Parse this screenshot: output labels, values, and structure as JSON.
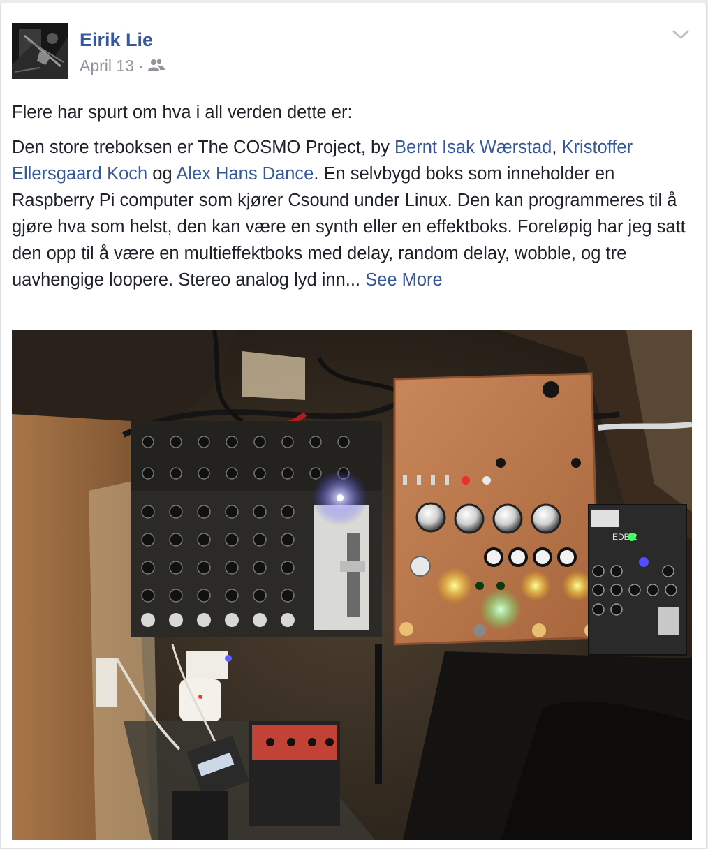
{
  "post": {
    "author": "Eirik Lie",
    "date": "April 13",
    "separator": "·",
    "audience_icon": "friends-icon",
    "options_icon": "chevron-down-icon",
    "intro": "Flere har spurt om hva i all verden dette er:",
    "text_before_link1": "Den store treboksen er The COSMO Project, by ",
    "link1": "Bernt Isak Wærstad",
    "sep1": ",",
    "link2": "Kristoffer Ellersgaard Koch",
    "og": " og ",
    "link3": "Alex Hans Dance",
    "text_after": ". En selvbygd boks som inneholder en Raspberry Pi computer som kjører Csound under Linux. Den kan programmeres til å gjøre hva som helst, den kan være en synth eller en effektboks. Foreløpig har jeg satt den opp til å være en multieffektboks med delay, random delay, wobble, og tre uavhengige loopere. Stereo analog lyd inn... ",
    "see_more": "See More"
  },
  "photo": {
    "device_label": "EDB-2"
  }
}
